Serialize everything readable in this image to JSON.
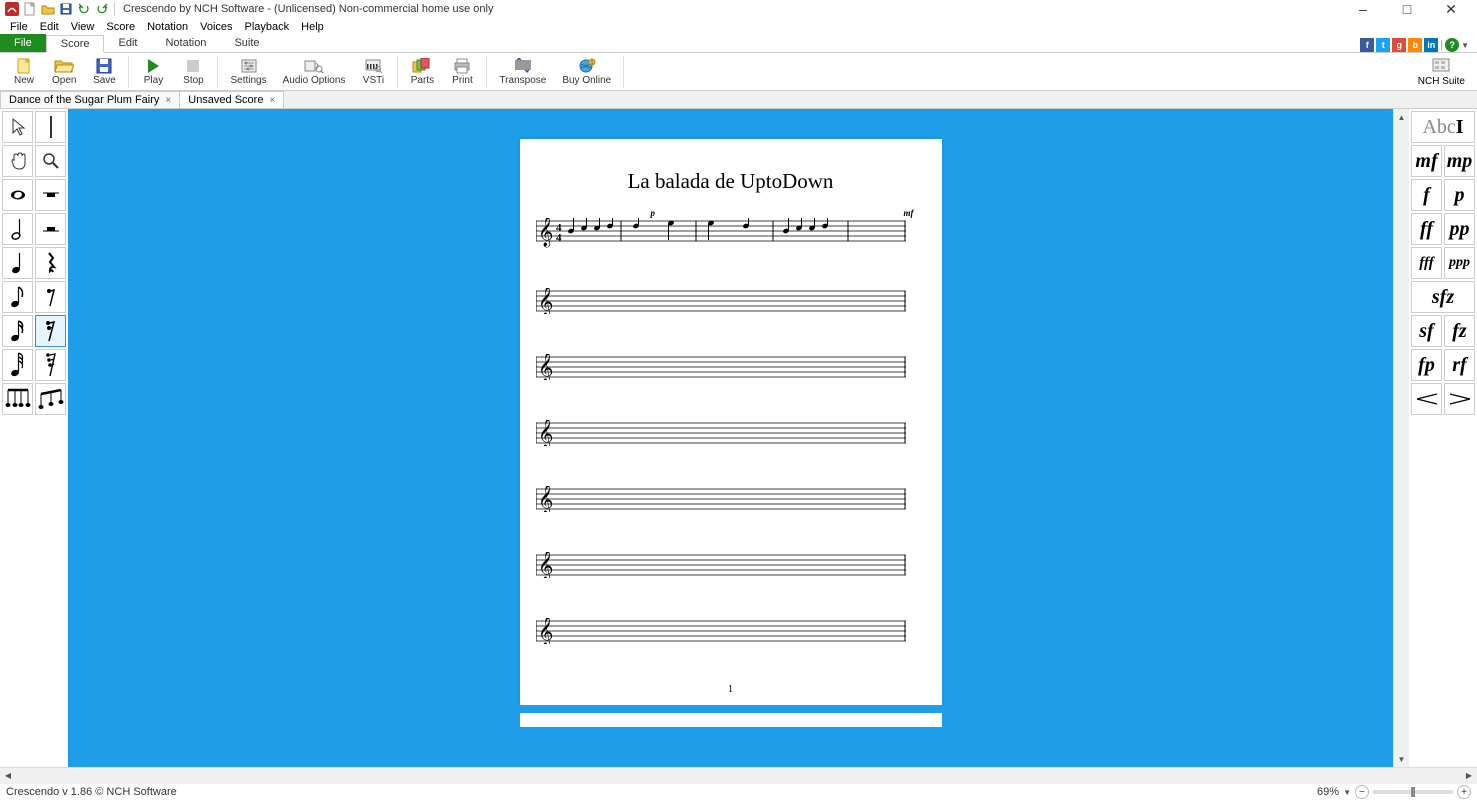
{
  "window": {
    "title": "Crescendo by NCH Software - (Unlicensed) Non-commercial home use only"
  },
  "menubar": {
    "items": [
      "File",
      "Edit",
      "View",
      "Score",
      "Notation",
      "Voices",
      "Playback",
      "Help"
    ]
  },
  "ribbon": {
    "file_tab": "File",
    "tabs": [
      "Score",
      "Edit",
      "Notation",
      "Suite"
    ],
    "active_tab_index": 0,
    "buttons": [
      {
        "label": "New",
        "icon": "new"
      },
      {
        "label": "Open",
        "icon": "open"
      },
      {
        "label": "Save",
        "icon": "save"
      },
      {
        "label": "Play",
        "icon": "play"
      },
      {
        "label": "Stop",
        "icon": "stop"
      },
      {
        "label": "Settings",
        "icon": "settings"
      },
      {
        "label": "Audio Options",
        "icon": "audio"
      },
      {
        "label": "VSTi",
        "icon": "vsti"
      },
      {
        "label": "Parts",
        "icon": "parts"
      },
      {
        "label": "Print",
        "icon": "print"
      },
      {
        "label": "Transpose",
        "icon": "transpose"
      },
      {
        "label": "Buy Online",
        "icon": "buy"
      }
    ],
    "nch_suite": "NCH Suite"
  },
  "doc_tabs": {
    "items": [
      {
        "label": "Dance of the Sugar Plum Fairy",
        "active": false
      },
      {
        "label": "Unsaved Score",
        "active": true
      }
    ]
  },
  "left_palette": {
    "rows": [
      [
        "cursor-icon",
        "barline-icon"
      ],
      [
        "hand-icon",
        "zoom-icon"
      ],
      [
        "whole-note-icon",
        "whole-rest-icon"
      ],
      [
        "half-note-icon",
        "half-rest-icon"
      ],
      [
        "quarter-note-icon",
        "quarter-rest-icon"
      ],
      [
        "eighth-note-icon",
        "eighth-rest-icon"
      ],
      [
        "sixteenth-note-icon",
        "sixteenth-rest-icon"
      ],
      [
        "thirtysecond-note-icon",
        "thirtysecond-rest-icon"
      ],
      [
        "beam-group-icon",
        "beam-notes-icon"
      ]
    ],
    "selected_row": 6,
    "selected_col": 1
  },
  "right_palette": {
    "rows": [
      [
        "text-tool"
      ],
      [
        "mf",
        "mp"
      ],
      [
        "f",
        "p"
      ],
      [
        "ff",
        "pp"
      ],
      [
        "fff",
        "ppp"
      ],
      [
        "sfz"
      ],
      [
        "sf",
        "fz"
      ],
      [
        "fp",
        "rf"
      ],
      [
        "crescendo",
        "decrescendo"
      ]
    ]
  },
  "score": {
    "title": "La balada de UptoDown",
    "page_number": "1",
    "dynamics": {
      "piano": "p",
      "mezzoforte": "mf"
    }
  },
  "statusbar": {
    "version": "Crescendo v 1.86 © NCH Software",
    "zoom": "69%"
  }
}
